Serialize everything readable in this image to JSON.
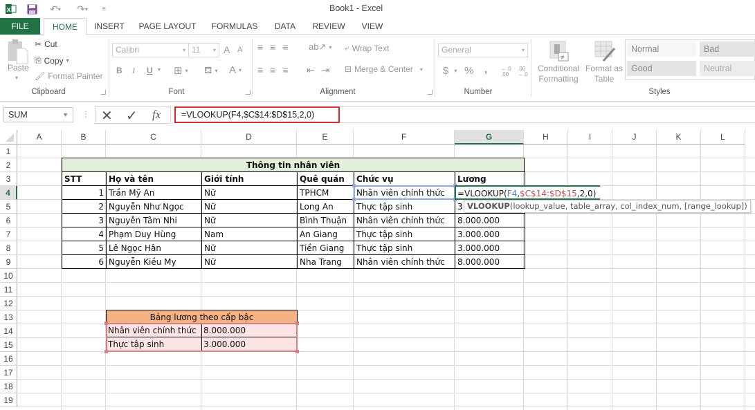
{
  "window": {
    "title": "Book1 - Excel"
  },
  "quick_access": {
    "icons": [
      "excel-logo-icon",
      "save-icon",
      "undo-icon",
      "redo-icon",
      "customize-icon"
    ]
  },
  "tabs": [
    {
      "label": "FILE"
    },
    {
      "label": "HOME"
    },
    {
      "label": "INSERT"
    },
    {
      "label": "PAGE LAYOUT"
    },
    {
      "label": "FORMULAS"
    },
    {
      "label": "DATA"
    },
    {
      "label": "REVIEW"
    },
    {
      "label": "VIEW"
    }
  ],
  "ribbon": {
    "clipboard": {
      "paste": "Paste",
      "cut": "Cut",
      "copy": "Copy",
      "format_painter": "Format Painter",
      "label": "Clipboard"
    },
    "font": {
      "name": "Calibri",
      "size": "11",
      "bold": "B",
      "italic": "I",
      "underline": "U",
      "font_color": "A",
      "grow": "A",
      "shrink": "A",
      "label": "Font"
    },
    "alignment": {
      "wrap_text": "Wrap Text",
      "merge_center": "Merge & Center",
      "label": "Alignment"
    },
    "number": {
      "format": "General",
      "currency": "$",
      "percent": "%",
      "comma": ",",
      "inc_decimal": "←.0 .00",
      "dec_decimal": ".00 →.0",
      "label": "Number"
    },
    "styles": {
      "conditional": "Conditional",
      "conditional2": "Formatting",
      "format_table": "Format as",
      "format_table2": "Table",
      "normal": "Normal",
      "bad": "Bad",
      "good": "Good",
      "neutral": "Neutral",
      "label": "Styles"
    }
  },
  "formula_bar": {
    "name_box": "SUM",
    "cancel": "✕",
    "enter": "✓",
    "fx": "fx",
    "formula": "=VLOOKUP(F4,$C$14:$D$15,2,0)"
  },
  "grid": {
    "columns": [
      "A",
      "B",
      "C",
      "D",
      "E",
      "F",
      "G",
      "H",
      "I",
      "J",
      "K",
      "L"
    ],
    "rows": [
      "1",
      "2",
      "3",
      "4",
      "5",
      "6",
      "7",
      "8",
      "9",
      "10",
      "11",
      "12",
      "13",
      "14",
      "15",
      "16",
      "17",
      "18",
      "19"
    ],
    "selected_column": "G",
    "selected_row": "4"
  },
  "employee_table": {
    "title": "Thông tin nhân viên",
    "headers": [
      "STT",
      "Họ và tên",
      "Giới tính",
      "Quê quán",
      "Chức vụ",
      "Lương"
    ],
    "rows": [
      {
        "stt": "1",
        "name": "Trần Mỹ An",
        "gender": "Nữ",
        "hometown": "TPHCM",
        "position": "Nhân viên chính thức",
        "salary": ""
      },
      {
        "stt": "2",
        "name": "Nguyễn Như Ngọc",
        "gender": "Nữ",
        "hometown": "Long An",
        "position": "Thực tập sinh",
        "salary": "3"
      },
      {
        "stt": "3",
        "name": "Nguyễn Tâm Nhi",
        "gender": "Nữ",
        "hometown": "Bình Thuận",
        "position": "Nhân viên chính thức",
        "salary": "8.000.000"
      },
      {
        "stt": "4",
        "name": "Phạm Duy Hùng",
        "gender": "Nam",
        "hometown": "An Giang",
        "position": "Thực tập sinh",
        "salary": "3.000.000"
      },
      {
        "stt": "5",
        "name": "Lê Ngọc Hân",
        "gender": "Nữ",
        "hometown": "Tiền Giang",
        "position": "Thực tập sinh",
        "salary": "3.000.000"
      },
      {
        "stt": "6",
        "name": "Nguyễn Kiều My",
        "gender": "Nữ",
        "hometown": "Nha Trang",
        "position": "Nhân viên chính thức",
        "salary": "8.000.000"
      }
    ]
  },
  "editing_cell": {
    "prefix": "=VLOOKUP(",
    "arg1": "F4",
    "comma1": ",",
    "arg2": "$C$14:$D$15",
    "rest": ",2,0)",
    "tooltip_fn": "VLOOKUP",
    "tooltip_args": "(lookup_value, table_array, col_index_num, [range_lookup])"
  },
  "salary_table": {
    "title": "Bảng lương theo cấp bậc",
    "rows": [
      {
        "position": "Nhân viên chính thức",
        "salary": "8.000.000"
      },
      {
        "position": "Thực tập sinh",
        "salary": "3.000.000"
      }
    ]
  },
  "colors": {
    "excel_green": "#217346",
    "title_fill": "#e2efda",
    "salary_header_fill": "#f4b183",
    "salary_body_fill": "#fce4e4",
    "ref_blue": "#4f81bd",
    "ref_red": "#c0504d",
    "formula_highlight": "#d22b32"
  }
}
